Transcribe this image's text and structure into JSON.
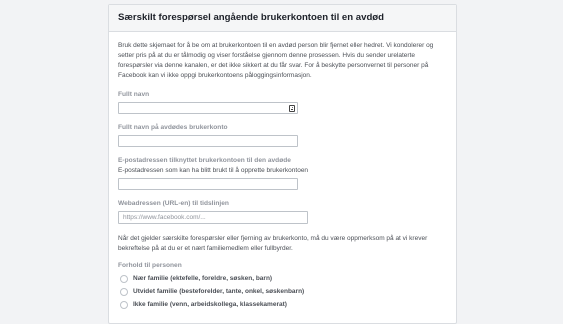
{
  "form": {
    "title": "Særskilt forespørsel angående brukerkontoen til en avdød",
    "intro": "Bruk dette skjemaet for å be om at brukerkontoen til en avdød person blir fjernet eller hedret. Vi kondolerer og setter pris på at du er tålmodig og viser forståelse gjennom denne prosessen. Hvis du sender urelaterte forespørsler via denne kanalen, er det ikke sikkert at du får svar. For å beskytte personvernet til personer på Facebook kan vi ikke oppgi brukerkontoens påloggingsinformasjon.",
    "full_name": {
      "label": "Fullt navn",
      "value": ""
    },
    "deceased_name": {
      "label": "Fullt navn på avdødes brukerkonto",
      "value": ""
    },
    "email": {
      "label": "E-postadressen tilknyttet brukerkontoen til den avdøde",
      "sublabel": "E-postadressen som kan ha blitt brukt til å opprette brukerkontoen",
      "value": ""
    },
    "url": {
      "label": "Webadressen (URL-en) til tidslinjen",
      "placeholder": "https://www.facebook.com/..."
    },
    "note": "Når det gjelder særskilte forespørsler eller fjerning av brukerkonto, må du være oppmerksom på at vi krever bekreftelse på at du er et nært familiemedlem eller fullbyrder.",
    "relationship": {
      "label": "Forhold til personen",
      "options": [
        "Nær familie (ektefelle, foreldre, søsken, barn)",
        "Utvidet familie (besteforelder, tante, onkel, søskenbarn)",
        "Ikke familie (venn, arbeidskollega, klassekamerat)"
      ]
    }
  }
}
